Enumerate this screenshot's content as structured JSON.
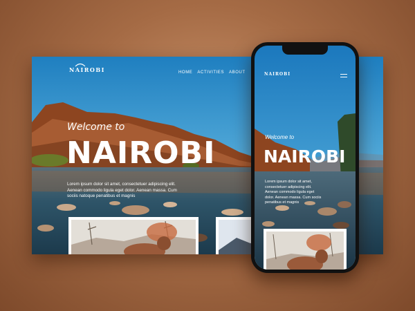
{
  "site": {
    "logo": "NAIROBI",
    "nav": [
      "HOME",
      "ACTIVITIES",
      "ABOUT"
    ],
    "welcome": "Welcome to",
    "title": "NAIROBI",
    "body_lines": [
      "Lorem ipsum dolor sit amet, consectetuer adipiscing elit.",
      "Aenean commodo ligula eget dolor. Aenean massa. Cum",
      "sociis natoque penatibus et magnis"
    ]
  },
  "mobile": {
    "logo": "NAIROBI",
    "welcome": "Welcome to",
    "title": "NAIROBI",
    "body_lines": [
      "Lorem ipsum dolor sit amet,",
      "consectetuer adipiscing elit.",
      "Aenean commodo ligula eget",
      "dolor. Aenean massa. Cum sociis",
      "penatibus et magnis"
    ]
  },
  "colors": {
    "background": "#a56b45",
    "sky": "#2a86c4",
    "mountain": "#9a4a22",
    "water": "#2f5a74",
    "text": "#ffffff"
  },
  "icons": [
    "logo-mark-icon",
    "hamburger-menu-icon"
  ]
}
